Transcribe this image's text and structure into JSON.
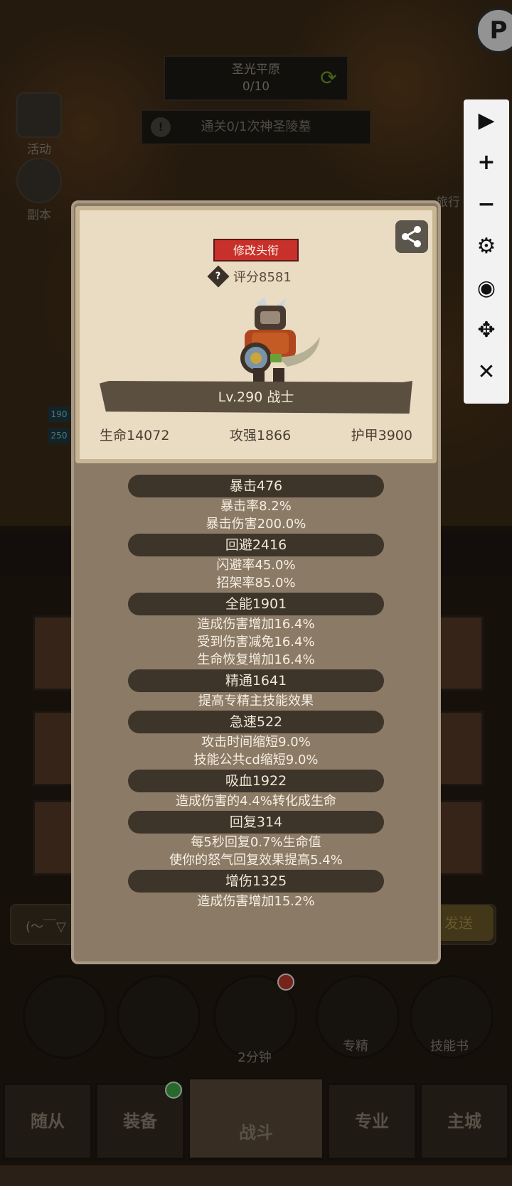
{
  "top": {
    "area_name": "圣光平原",
    "area_progress": "0/10",
    "quest": "通关0/1次神圣陵墓",
    "quest_alert": "!",
    "left_buttons": [
      "活动",
      "副本"
    ],
    "right_button": "旅行",
    "corner_logo": "P"
  },
  "toolbar": {
    "icons": [
      "play-icon",
      "zoom-in-icon",
      "zoom-out-icon",
      "gear-icon",
      "eye-icon",
      "move-icon",
      "close-icon"
    ],
    "glyphs": [
      "▶",
      "+",
      "−",
      "⚙",
      "◉",
      "✥",
      "✕"
    ]
  },
  "profile": {
    "title_button": "修改头衔",
    "score_icon": "?",
    "score": "评分8581",
    "level": "Lv.290 战士",
    "hp": "生命14072",
    "attack": "攻强1866",
    "armor": "护甲3900"
  },
  "stats": [
    {
      "header": "暴击476",
      "lines": [
        "暴击率8.2%",
        "暴击伤害200.0%"
      ]
    },
    {
      "header": "回避2416",
      "lines": [
        "闪避率45.0%",
        "招架率85.0%"
      ]
    },
    {
      "header": "全能1901",
      "lines": [
        "造成伤害增加16.4%",
        "受到伤害减免16.4%",
        "生命恢复增加16.4%"
      ]
    },
    {
      "header": "精通1641",
      "lines": [
        "提高专精主技能效果"
      ]
    },
    {
      "header": "急速522",
      "lines": [
        "攻击时间缩短9.0%",
        "技能公共cd缩短9.0%"
      ]
    },
    {
      "header": "吸血1922",
      "lines": [
        "造成伤害的4.4%转化成生命"
      ]
    },
    {
      "header": "回复314",
      "lines": [
        "每5秒回复0.7%生命值",
        "使你的怒气回复效果提高5.4%"
      ]
    },
    {
      "header": "增伤1325",
      "lines": [
        "造成伤害增加15.2%"
      ]
    }
  ],
  "background": {
    "badges": [
      "190",
      "250"
    ],
    "chat_placeholder": "(～￣▽",
    "chat_send": "发送",
    "timer": "2分钟",
    "specialty": "专精",
    "skill_book": "技能书"
  },
  "nav": {
    "tabs": [
      "随从",
      "装备",
      "战斗",
      "专业",
      "主城"
    ]
  }
}
